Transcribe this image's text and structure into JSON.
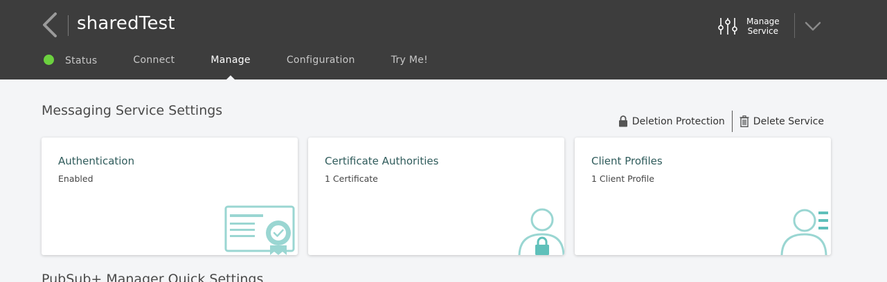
{
  "header": {
    "service_name": "sharedTest",
    "manage_service_line1": "Manage",
    "manage_service_line2": "Service"
  },
  "tabs": [
    {
      "label": "Status"
    },
    {
      "label": "Connect"
    },
    {
      "label": "Manage",
      "active": true
    },
    {
      "label": "Configuration"
    },
    {
      "label": "Try Me!"
    }
  ],
  "status_color": "#6cd13f",
  "section": {
    "title": "Messaging Service Settings",
    "deletion_protection": "Deletion Protection",
    "delete_service": "Delete Service"
  },
  "cards": [
    {
      "title": "Authentication",
      "subtitle": "Enabled",
      "icon": "certificate-icon"
    },
    {
      "title": "Certificate Authorities",
      "subtitle": "1 Certificate",
      "icon": "user-lock-icon"
    },
    {
      "title": "Client Profiles",
      "subtitle": "1 Client Profile",
      "icon": "user-list-icon"
    }
  ],
  "next_section_title": "PubSub+ Manager Quick Settings",
  "colors": {
    "header_bg": "#3d3d3d",
    "illustration": "#9ad6d2",
    "illustration_dark": "#5fc0ba"
  }
}
